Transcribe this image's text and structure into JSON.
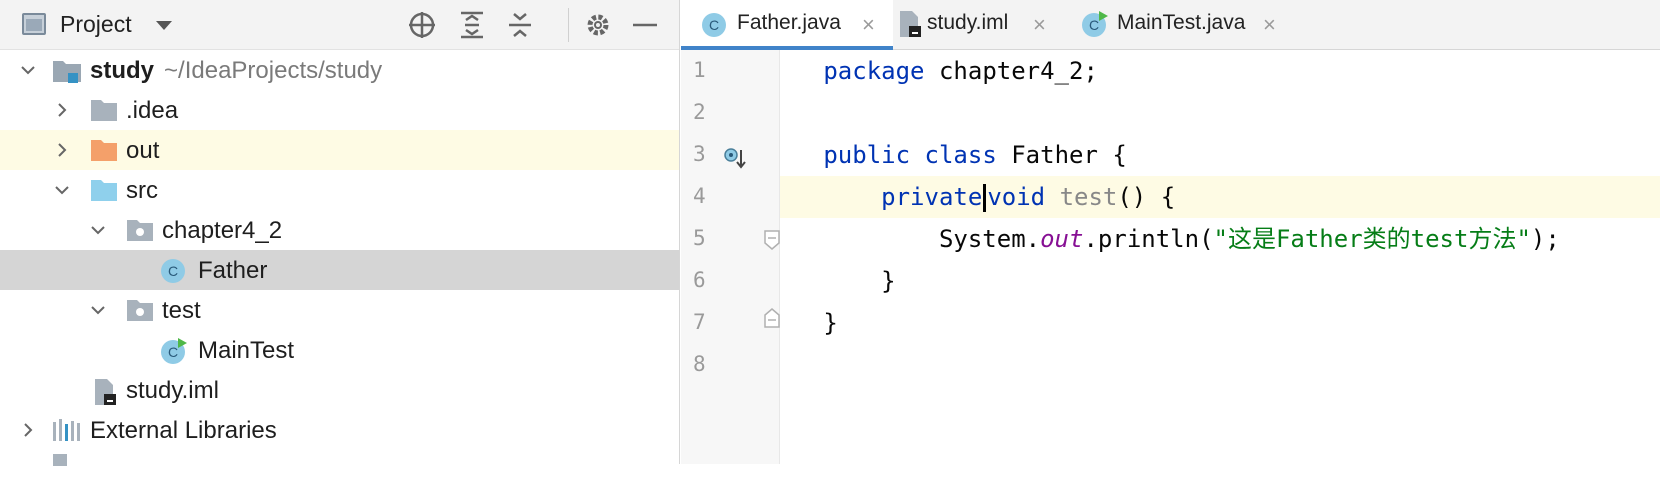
{
  "project_panel": {
    "title": "Project",
    "tree": [
      {
        "label": "study",
        "path": "~/IdeaProjects/study"
      },
      {
        "label": ".idea"
      },
      {
        "label": "out"
      },
      {
        "label": "src"
      },
      {
        "label": "chapter4_2"
      },
      {
        "label": "Father"
      },
      {
        "label": "test"
      },
      {
        "label": "MainTest"
      },
      {
        "label": "study.iml"
      },
      {
        "label": "External Libraries"
      }
    ]
  },
  "editor": {
    "tabs": [
      {
        "label": "Father.java",
        "close": "×"
      },
      {
        "label": "study.iml",
        "close": "×"
      },
      {
        "label": "MainTest.java",
        "close": "×"
      }
    ],
    "line_numbers": [
      "1",
      "2",
      "3",
      "4",
      "5",
      "6",
      "7",
      "8"
    ],
    "code": {
      "l1_kw": "package",
      "l1_rest": " chapter4_2;",
      "l3_kw1": "public",
      "l3_kw2": "class",
      "l3_rest": " Father {",
      "l4_kw1": "private",
      "l4_kw2": "void",
      "l4_fn": "test",
      "l4_rest": "() {",
      "l5_a": "System.",
      "l5_field": "out",
      "l5_b": ".println(",
      "l5_str": "\"这是Father类的test方法\"",
      "l5_c": ");",
      "l6": "}",
      "l7": "}"
    }
  },
  "colors": {
    "keyword": "#0033b3",
    "string": "#067d17",
    "static_field": "#871094",
    "highlight_line": "#fefbe4",
    "selected_row": "#d5d5d5",
    "active_tab_underline": "#4083c9"
  }
}
